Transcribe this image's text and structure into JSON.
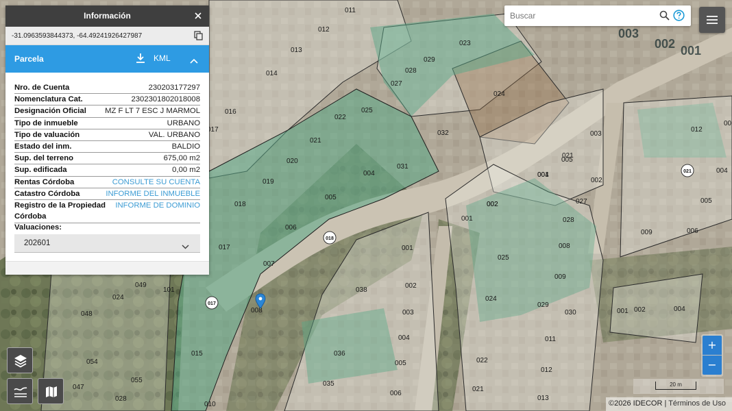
{
  "info_panel": {
    "title": "Información",
    "coordinates": "-31.0963593844373, -64.49241926427987",
    "section_title": "Parcela",
    "kml_label": "KML",
    "attributes": [
      {
        "key": "Nro. de Cuenta",
        "value": "230203177297"
      },
      {
        "key": "Nomenclatura Cat.",
        "value": "2302301802018008"
      },
      {
        "key": "Designación Oficial",
        "value": "MZ F LT 7 ESC J MARMOL"
      },
      {
        "key": "Tipo de inmueble",
        "value": "URBANO"
      },
      {
        "key": "Tipo de valuación",
        "value": "VAL. URBANO"
      },
      {
        "key": "Estado del inm.",
        "value": "BALDIO"
      },
      {
        "key": "Sup. del terreno",
        "value": "675,00 m2"
      },
      {
        "key": "Sup. edificada",
        "value": "0,00 m2"
      },
      {
        "key": "Rentas Córdoba",
        "value": "CONSULTE SU CUENTA"
      },
      {
        "key": "Catastro Córdoba",
        "value": "INFORME DEL INMUEBLE"
      },
      {
        "key": "Registro de la Propiedad Córdoba",
        "value": "INFORME DE DOMINIO"
      }
    ],
    "valuaciones_label": "Valuaciones:",
    "valuacion_selected": "202601"
  },
  "search": {
    "placeholder": "Buscar"
  },
  "zoom": {
    "in_label": "+",
    "out_label": "−"
  },
  "scale": {
    "label": "20 m"
  },
  "attribution": {
    "copyright": "©2026 IDECOR",
    "separator": " | ",
    "terms": "Términos de Uso"
  },
  "map": {
    "parcel_labels": [
      "011",
      "012",
      "013",
      "014",
      "016",
      "017",
      "023",
      "029",
      "028",
      "027",
      "024",
      "022",
      "025",
      "032",
      "031",
      "021",
      "020",
      "019",
      "018",
      "004",
      "005",
      "006",
      "017",
      "007",
      "008",
      "015",
      "010",
      "005",
      "003",
      "002",
      "001",
      "012",
      "002",
      "004",
      "005",
      "006",
      "009",
      "021",
      "002",
      "001",
      "004",
      "001",
      "027",
      "028",
      "008",
      "025",
      "009",
      "024",
      "029",
      "030",
      "011",
      "012",
      "013",
      "022",
      "021",
      "038",
      "002",
      "003",
      "004",
      "036",
      "005",
      "035",
      "006",
      "049",
      "101",
      "024",
      "048",
      "054",
      "055",
      "047",
      "028",
      "001",
      "002",
      "004",
      "002"
    ],
    "road_markers": [
      "018",
      "017",
      "021"
    ],
    "block_labels": [
      "003",
      "002",
      "001"
    ],
    "colors": {
      "panel_header": "#3f3f3f",
      "parcela_bar": "#2e9be3",
      "link": "#3b9bd3",
      "zoom_button": "#2b7fd0",
      "control_bg": "#4a4a4a",
      "selected_parcel": "#5aa887",
      "pin": "#2b86d6"
    }
  },
  "icons": {
    "close": "close-icon",
    "copy": "copy-icon",
    "download": "download-icon",
    "collapse": "chevron-up-icon",
    "dropdown": "chevron-down-icon",
    "search": "search-icon",
    "help": "help-icon",
    "menu": "menu-icon",
    "layers": "layers-icon",
    "baselayer": "base-layer-icon",
    "map": "map-icon",
    "pin": "location-pin-icon"
  }
}
